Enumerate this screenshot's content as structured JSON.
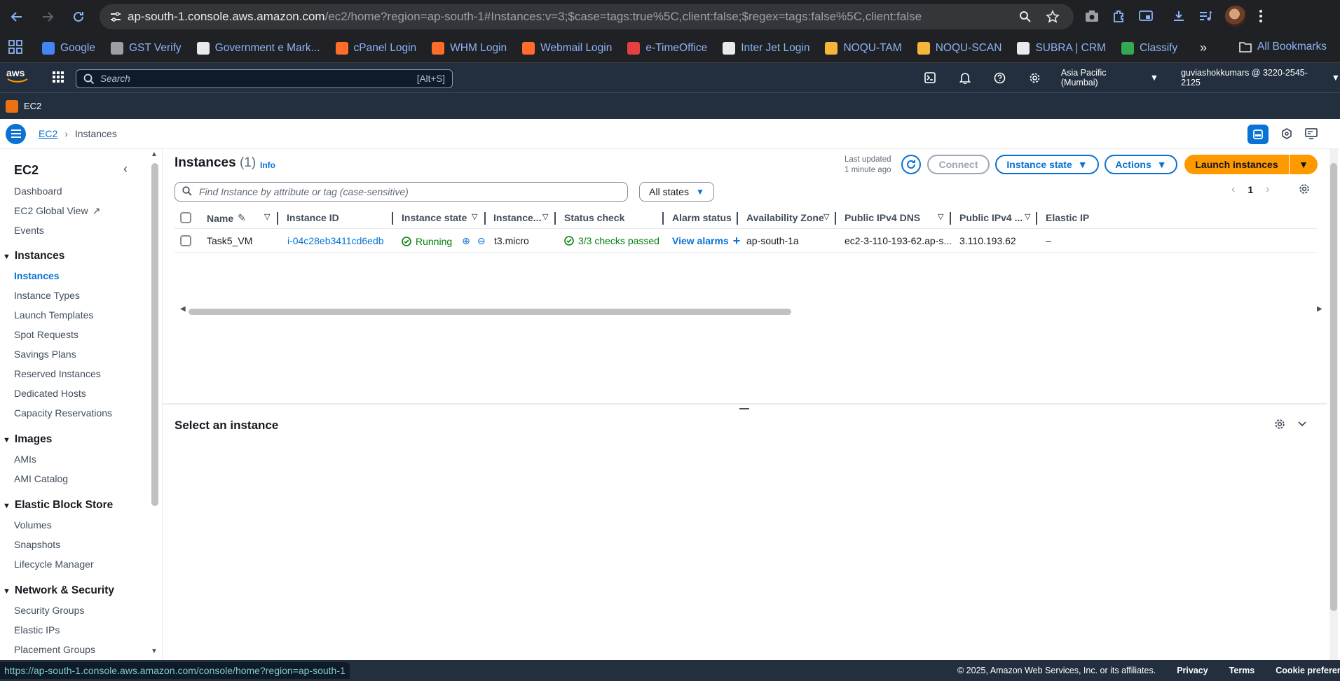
{
  "browser": {
    "url_host": "ap-south-1.console.aws.amazon.com",
    "url_path": "/ec2/home?region=ap-south-1#Instances:v=3;$case=tags:true%5C,client:false;$regex=tags:false%5C,client:false"
  },
  "bookmarks": [
    {
      "label": "Google",
      "color": "#4285f4"
    },
    {
      "label": "GST Verify",
      "color": "#9aa0a6"
    },
    {
      "label": "Government e Mark...",
      "color": "#e8eaed"
    },
    {
      "label": "cPanel Login",
      "color": "#ff6c2c"
    },
    {
      "label": "WHM Login",
      "color": "#ff6c2c"
    },
    {
      "label": "Webmail Login",
      "color": "#ff6c2c"
    },
    {
      "label": "e-TimeOffice",
      "color": "#e34040"
    },
    {
      "label": "Inter Jet Login",
      "color": "#e8eaed"
    },
    {
      "label": "NOQU-TAM",
      "color": "#f6b53b"
    },
    {
      "label": "NOQU-SCAN",
      "color": "#f6b53b"
    },
    {
      "label": "SUBRA | CRM",
      "color": "#e8eaed"
    },
    {
      "label": "Classify",
      "color": "#34a853"
    }
  ],
  "bookmarks_all": "All Bookmarks",
  "aws": {
    "search_placeholder": "Search",
    "search_shortcut": "[Alt+S]",
    "region": "Asia Pacific (Mumbai)",
    "account": "guviashokkumars @ 3220-2545-2125",
    "service": "EC2"
  },
  "breadcrumb": {
    "root": "EC2",
    "current": "Instances"
  },
  "sidebar": {
    "title": "EC2",
    "top_items": [
      "Dashboard",
      "EC2 Global View",
      "Events"
    ],
    "sections": [
      {
        "title": "Instances",
        "items": [
          "Instances",
          "Instance Types",
          "Launch Templates",
          "Spot Requests",
          "Savings Plans",
          "Reserved Instances",
          "Dedicated Hosts",
          "Capacity Reservations"
        ]
      },
      {
        "title": "Images",
        "items": [
          "AMIs",
          "AMI Catalog"
        ]
      },
      {
        "title": "Elastic Block Store",
        "items": [
          "Volumes",
          "Snapshots",
          "Lifecycle Manager"
        ]
      },
      {
        "title": "Network & Security",
        "items": [
          "Security Groups",
          "Elastic IPs",
          "Placement Groups"
        ]
      }
    ]
  },
  "header": {
    "title": "Instances",
    "count": "(1)",
    "info": "Info",
    "last_updated_line1": "Last updated",
    "last_updated_line2": "1 minute ago",
    "connect": "Connect",
    "instance_state": "Instance state",
    "actions": "Actions",
    "launch": "Launch instances"
  },
  "filter": {
    "placeholder": "Find Instance by attribute or tag (case-sensitive)",
    "states": "All states",
    "page": "1"
  },
  "table": {
    "columns": [
      "Name",
      "Instance ID",
      "Instance state",
      "Instance...",
      "Status check",
      "Alarm status",
      "Availability Zone",
      "Public IPv4 DNS",
      "Public IPv4 ...",
      "Elastic IP"
    ],
    "row": {
      "name": "Task5_VM",
      "id": "i-04c28eb3411cd6edb",
      "state": "Running",
      "type": "t3.micro",
      "status": "3/3 checks passed",
      "alarm": "View alarms",
      "az": "ap-south-1a",
      "dns": "ec2-3-110-193-62.ap-s...",
      "ipv4": "3.110.193.62",
      "eip": "–"
    }
  },
  "detail": {
    "title": "Select an instance"
  },
  "footer": {
    "status_url": "https://ap-south-1.console.aws.amazon.com/console/home?region=ap-south-1",
    "copyright": "© 2025, Amazon Web Services, Inc. or its affiliates.",
    "privacy": "Privacy",
    "terms": "Terms",
    "cookies": "Cookie preferences"
  }
}
